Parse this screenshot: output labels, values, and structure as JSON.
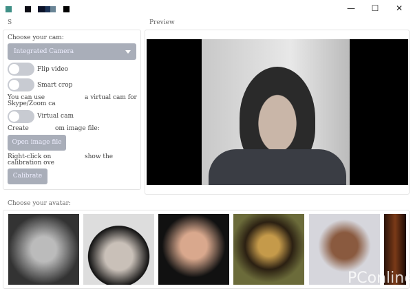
{
  "window": {
    "title_colors": [
      "#3f8f86",
      "#0c0c14",
      "#dfe8e8",
      "#0b1228",
      "#1c3356",
      "#6a8596",
      "#000000"
    ],
    "minimize": "—",
    "maximize": "☐",
    "close": "✕"
  },
  "settings": {
    "section_label": "S",
    "choose_cam_label": "Choose your cam:",
    "cam_selected": "Integrated Camera",
    "flip_label": "Flip video",
    "flip_on": false,
    "crop_label": "Smart crop",
    "crop_on": false,
    "vcam_note_1": "You can use",
    "vcam_note_2": "a virtual cam for",
    "vcam_note_3": "Skype/Zoom ca",
    "vcam_label": "Virtual cam",
    "vcam_on": false,
    "create_label_1": "Create",
    "create_label_2": "om image file:",
    "open_button": "Open image file",
    "calib_note_1": "Right-click on",
    "calib_note_2": "show the",
    "calib_note_3": "calibration ove",
    "calibrate_button": "Calibrate"
  },
  "preview": {
    "label": "Preview"
  },
  "avatars": {
    "label": "Choose your avatar:",
    "items": [
      "einstein",
      "eminem",
      "jobs",
      "mona-lisa",
      "obama",
      "partial"
    ]
  },
  "watermark": "PConline"
}
